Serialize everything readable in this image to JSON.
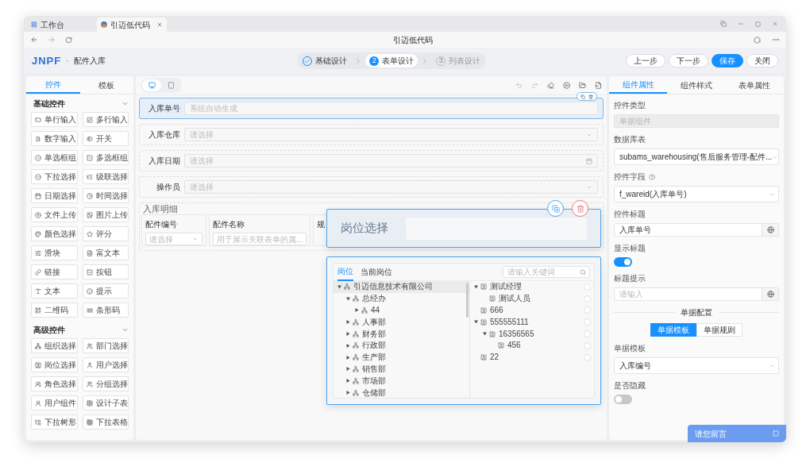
{
  "browser": {
    "tabs": [
      {
        "label": "工作台",
        "selected": false
      },
      {
        "label": "引迈低代码",
        "selected": true
      }
    ],
    "title": "引迈低代码"
  },
  "header": {
    "logo": "JNPF",
    "separator": "·",
    "page_title": "配件入库",
    "steps": [
      {
        "label": "基础设计",
        "kind": "done"
      },
      {
        "number": "2",
        "label": "表单设计",
        "kind": "active"
      },
      {
        "number": "3",
        "label": "列表设计",
        "kind": "todo"
      }
    ],
    "buttons": [
      {
        "label": "上一步",
        "kind": "default"
      },
      {
        "label": "下一步",
        "kind": "default"
      },
      {
        "label": "保存",
        "kind": "primary"
      },
      {
        "label": "关闭",
        "kind": "default"
      }
    ]
  },
  "left_panel": {
    "tabs": [
      {
        "label": "控件",
        "selected": true
      },
      {
        "label": "模板",
        "selected": false
      }
    ],
    "groups": [
      {
        "title": "基础控件",
        "expanded": true,
        "items": [
          "单行输入",
          "多行输入",
          "数字输入",
          "开关",
          "单选框组",
          "多选框组",
          "下拉选择",
          "级联选择",
          "日期选择",
          "时间选择",
          "文件上传",
          "图片上传",
          "颜色选择",
          "评分",
          "滑块",
          "富文本",
          "链接",
          "按钮",
          "文本",
          "提示",
          "二维码",
          "条形码"
        ]
      },
      {
        "title": "高级控件",
        "expanded": true,
        "items": [
          "组织选择",
          "部门选择",
          "岗位选择",
          "用户选择",
          "角色选择",
          "分组选择",
          "用户组件",
          "设计子表",
          "下拉树形",
          "下拉表格"
        ]
      }
    ]
  },
  "canvas": {
    "devices": [
      {
        "kind": "desktop",
        "selected": true
      },
      {
        "kind": "mobile",
        "selected": false
      }
    ],
    "fields": [
      {
        "label": "入库单号",
        "placeholder": "系统自动生成",
        "kind": "text",
        "selected": true
      },
      {
        "label": "入库仓库",
        "placeholder": "请选择",
        "kind": "select",
        "selected": false
      },
      {
        "label": "入库日期",
        "placeholder": "请选择",
        "kind": "date",
        "selected": false
      },
      {
        "label": "操作员",
        "placeholder": "请选择",
        "kind": "select",
        "selected": false
      }
    ],
    "subtable": {
      "title": "入库明细",
      "columns": [
        {
          "label": "配件编号",
          "placeholder": "请选择",
          "kind": "select"
        },
        {
          "label": "配件名称",
          "placeholder": "用于展示关联表单的属...",
          "kind": "input"
        },
        {
          "label": "规",
          "kind": "cut"
        }
      ]
    },
    "dragged": {
      "label": "岗位选择"
    },
    "picker": {
      "tabs": [
        {
          "label": "岗位",
          "selected": true
        },
        {
          "label": "当前岗位",
          "selected": false
        }
      ],
      "search_placeholder": "请输入关键词",
      "left_tree": [
        {
          "label": "引迈信息技术有限公司",
          "expanded": true,
          "selected": true,
          "children": [
            {
              "label": "总经办",
              "expanded": true,
              "selected": false,
              "children": [
                {
                  "label": "44",
                  "expanded": false,
                  "selected": false
                }
              ]
            },
            {
              "label": "人事部",
              "expanded": false,
              "selected": false
            },
            {
              "label": "财务部",
              "expanded": false,
              "selected": false
            },
            {
              "label": "行政部",
              "expanded": false,
              "selected": false
            },
            {
              "label": "生产部",
              "expanded": false,
              "selected": false
            },
            {
              "label": "销售部",
              "expanded": false,
              "selected": false
            },
            {
              "label": "市场部",
              "expanded": false,
              "selected": false
            },
            {
              "label": "仓储部",
              "expanded": false,
              "selected": false
            }
          ]
        }
      ],
      "right_tree": [
        {
          "label": "测试经理",
          "expanded": true,
          "selected": false,
          "children": [
            {
              "label": "测试人员",
              "selected": false
            }
          ]
        },
        {
          "label": "666",
          "selected": false
        },
        {
          "label": "555555111",
          "expanded": true,
          "selected": false,
          "children": [
            {
              "label": "16356565",
              "expanded": true,
              "selected": false,
              "children": [
                {
                  "label": "456",
                  "selected": false
                }
              ]
            }
          ]
        },
        {
          "label": "22",
          "selected": false
        }
      ]
    }
  },
  "right_panel": {
    "tabs": [
      {
        "label": "组件属性",
        "selected": true
      },
      {
        "label": "组件样式",
        "selected": false
      },
      {
        "label": "表单属性",
        "selected": false
      }
    ],
    "properties": [
      {
        "kind": "input",
        "label": "控件类型",
        "value": "单据组件",
        "disabled": true
      },
      {
        "kind": "select",
        "label": "数据库表",
        "value": "subams_warehousing(售后服务管理-配件..."
      },
      {
        "kind": "select",
        "label": "控件字段",
        "help": true,
        "value": "f_wareid(入库单号)"
      },
      {
        "kind": "translatable",
        "label": "控件标题",
        "value": "入库单号"
      },
      {
        "kind": "switch",
        "label": "显示标题",
        "on": true
      },
      {
        "kind": "translatable",
        "label": "标题提示",
        "placeholder": "请输入"
      },
      {
        "kind": "divider",
        "label": "单据配置"
      },
      {
        "kind": "segmented",
        "options": [
          {
            "label": "单据模板",
            "selected": true
          },
          {
            "label": "单据规则",
            "selected": false
          }
        ]
      },
      {
        "kind": "select",
        "label": "单据模板",
        "value": "入库编号"
      },
      {
        "kind": "switch",
        "label": "是否隐藏",
        "on": false
      }
    ]
  },
  "chat": {
    "label": "请您留言"
  }
}
